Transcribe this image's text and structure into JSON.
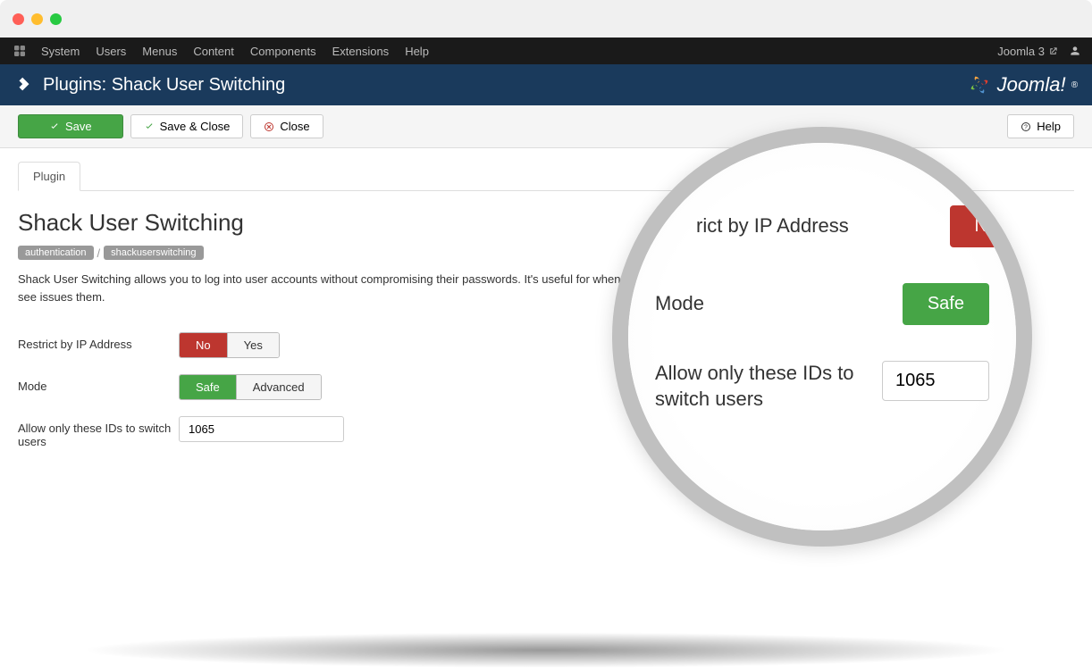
{
  "nav": {
    "items": [
      "System",
      "Users",
      "Menus",
      "Content",
      "Components",
      "Extensions",
      "Help"
    ],
    "right_link": "Joomla 3"
  },
  "title": "Plugins: Shack User Switching",
  "brand": "Joomla!",
  "toolbar": {
    "save": "Save",
    "save_close": "Save & Close",
    "close": "Close",
    "help": "Help"
  },
  "tab": "Plugin",
  "heading": "Shack User Switching",
  "badges": [
    "authentication",
    "shackuserswitching"
  ],
  "description": "Shack User Switching allows you to log into user accounts without compromising their passwords. It's useful for when you want to see issues them.",
  "form": {
    "restrict_label": "Restrict by IP Address",
    "restrict_no": "No",
    "restrict_yes": "Yes",
    "mode_label": "Mode",
    "mode_safe": "Safe",
    "mode_advanced": "Advanced",
    "ids_label": "Allow only these IDs to switch users",
    "ids_value": "1065"
  },
  "magnifier": {
    "restrict_label": "rict by IP Address",
    "restrict_value": "N",
    "mode_label": "Mode",
    "mode_value": "Safe",
    "ids_label": "Allow only these IDs to switch users",
    "ids_value": "1065"
  }
}
